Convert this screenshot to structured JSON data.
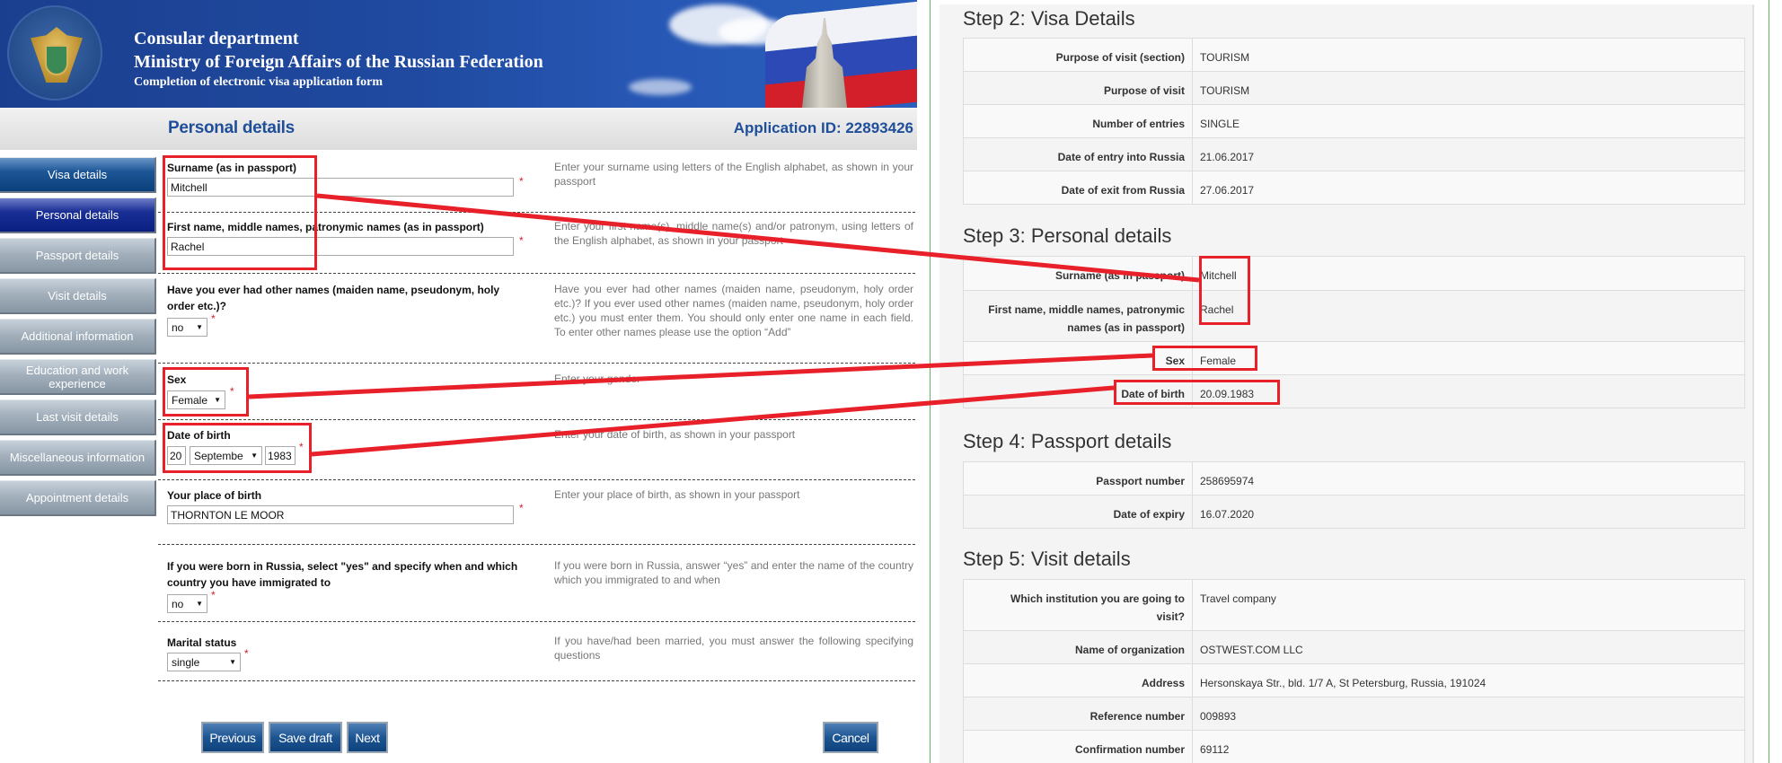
{
  "header": {
    "line1": "Consular department",
    "line2": "Ministry of Foreign Affairs of the Russian Federation",
    "line3": "Completion of electronic visa application form",
    "emblem_icon": "double-headed-eagle-emblem",
    "flag_icon": "russian-flag-with-mfa-building"
  },
  "titlebar": {
    "page_title": "Personal details",
    "application_id": "Application ID: 22893426"
  },
  "nav": {
    "items": [
      {
        "label": "Visa details",
        "state": "done"
      },
      {
        "label": "Personal details",
        "state": "active"
      },
      {
        "label": "Passport details",
        "state": "pending"
      },
      {
        "label": "Visit details",
        "state": "pending"
      },
      {
        "label": "Additional information",
        "state": "pending"
      },
      {
        "label": "Education and work experience",
        "state": "pending"
      },
      {
        "label": "Last visit details",
        "state": "pending"
      },
      {
        "label": "Miscellaneous information",
        "state": "pending"
      },
      {
        "label": "Appointment details",
        "state": "pending"
      }
    ]
  },
  "form": {
    "required_mark": "*",
    "surname": {
      "label": "Surname (as in passport)",
      "value": "Mitchell",
      "help": "Enter your surname using letters of the English alphabet, as shown in your passport"
    },
    "first_name": {
      "label": "First name, middle names, patronymic names (as in passport)",
      "value": "Rachel",
      "help": "Enter your first name(s), middle name(s) and/or patronym, using letters of the English alphabet, as shown in your passport"
    },
    "other_names": {
      "label": "Have you ever had other names (maiden name, pseudonym, holy order etc.)?",
      "value": "no",
      "help": "Have you ever had other names (maiden name, pseudonym, holy order etc.)? If you ever used other names (maiden name, pseudonym, holy order etc.) you must enter them. You should only enter one name in each field. To enter other names please use the option “Add”"
    },
    "sex": {
      "label": "Sex",
      "value": "Female",
      "help": "Enter your gender"
    },
    "date_of_birth": {
      "label": "Date of birth",
      "day": "20",
      "month": "Septembe",
      "year": "1983",
      "help": "Enter your date of birth, as shown in your passport"
    },
    "place_of_birth": {
      "label": "Your place of birth",
      "value": "THORNTON LE MOOR",
      "help": "Enter your place of birth, as shown in your passport"
    },
    "born_in_russia": {
      "label": "If you were born in Russia, select \"yes\" and specify when and which country you have immigrated to",
      "value": "no",
      "help": "If you were born in Russia, answer “yes” and enter the name of the country which you immigrated to and when"
    },
    "marital_status": {
      "label": "Marital status",
      "value": "single",
      "help": "If you have/had been married, you must answer the following specifying questions"
    }
  },
  "buttons": {
    "previous": "Previous",
    "save_draft": "Save draft",
    "next": "Next",
    "cancel": "Cancel"
  },
  "summary": {
    "step2": {
      "title": "Step 2: Visa Details",
      "rows": [
        {
          "k": "Purpose of visit (section)",
          "v": "TOURISM"
        },
        {
          "k": "Purpose of visit",
          "v": "TOURISM"
        },
        {
          "k": "Number of entries",
          "v": "SINGLE"
        },
        {
          "k": "Date of entry into Russia",
          "v": "21.06.2017"
        },
        {
          "k": "Date of exit from Russia",
          "v": "27.06.2017"
        }
      ]
    },
    "step3": {
      "title": "Step 3: Personal details",
      "rows": [
        {
          "k": "Surname (as in passport)",
          "v": "Mitchell"
        },
        {
          "k": "First name, middle names, patronymic names (as in passport)",
          "v": "Rachel"
        },
        {
          "k": "Sex",
          "v": "Female"
        },
        {
          "k": "Date of birth",
          "v": "20.09.1983"
        }
      ]
    },
    "step4": {
      "title": "Step 4: Passport details",
      "rows": [
        {
          "k": "Passport number",
          "v": "258695974"
        },
        {
          "k": "Date of expiry",
          "v": "16.07.2020"
        }
      ]
    },
    "step5": {
      "title": "Step 5: Visit details",
      "rows": [
        {
          "k": "Which institution you are going to visit?",
          "v": "Travel company"
        },
        {
          "k": "Name of organization",
          "v": "OSTWEST.COM LLC"
        },
        {
          "k": "Address",
          "v": "Hersonskaya Str., bld. 1/7 A, St Petersburg, Russia, 191024"
        },
        {
          "k": "Reference number",
          "v": "009893"
        },
        {
          "k": "Confirmation number",
          "v": "69112"
        }
      ]
    }
  },
  "colors": {
    "annotation": "#e8202a",
    "title_blue": "#1f4e9a",
    "divider_green": "#5cb85c"
  }
}
